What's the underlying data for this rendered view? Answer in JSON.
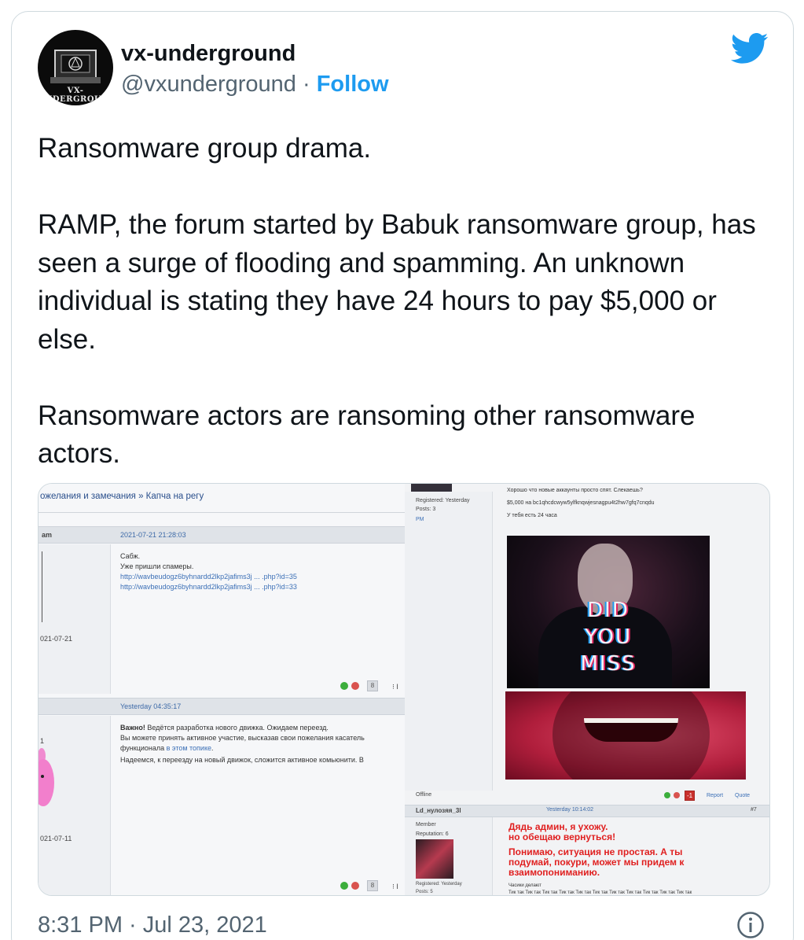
{
  "tweet": {
    "author_name": "vx-underground",
    "handle": "@vxunderground",
    "separator": "·",
    "follow_label": "Follow",
    "avatar_text": "VX-UNDERGROUND",
    "text": "Ransomware group drama.\n\nRAMP, the forum started by Babuk ransomware group, has seen a surge of flooding and spamming. An unknown individual is stating they have 24 hours to pay $5,000 or else.\n\nRansomware actors are ransoming other ransomware actors.",
    "timestamp": "8:31 PM · Jul 23, 2021",
    "icons": {
      "platform": "twitter-bird-icon",
      "info": "info-icon"
    },
    "colors": {
      "link": "#1d9bf0",
      "muted": "#536471",
      "text": "#0f1419"
    }
  },
  "forum_left": {
    "breadcrumb": "ожелания и замечания » Капча на регу",
    "post1": {
      "author_fragment": "am",
      "date": "2021-07-21 21:28:03",
      "lines": [
        "Сабж.",
        "Уже пришли спамеры."
      ],
      "links": [
        "http://wavbeudogz6byhnardd2lkp2jafims3j ... .php?id=35",
        "http://wavbeudogz6byhnardd2lkp2jafims3j ... .php?id=33"
      ],
      "joined": "021-07-21",
      "page_box": "8",
      "page_dots": "⁝ I"
    },
    "post2": {
      "date": "Yesterday 04:35:17",
      "bold_lead": "Важно!",
      "line1": "Ведётся разработка нового движка. Ожидаем переезд.",
      "line2": "Вы можете принять активное участие, высказав свои пожелания касатель",
      "line3_pre": "функционала ",
      "line3_link": "в этом топике",
      "line3_post": ".",
      "line4": "Надеемся, к переезду на новый движок, сложится активное комьюнити. В",
      "side_num": "1",
      "joined": "021-07-11",
      "page_box": "8",
      "page_dots": "⁝ I"
    }
  },
  "forum_right": {
    "top_side": {
      "registered": "Registered: Yesterday",
      "posts": "Posts: 3",
      "pm": "PM"
    },
    "top_lines": [
      "Хорошо что новые аккаунты просто спят. Слекаешь?",
      "$5,000 на bc1qhcdcwyw5ylfknqwjesnagpu4t2hw7gfq7cnqdu",
      "У тебя есть 24 часа"
    ],
    "image1_words": [
      "DID",
      "YOU",
      "MISS"
    ],
    "offline": "Offline",
    "vote_box": "-1",
    "report_label": "Report",
    "quote_label": "Quote",
    "post2": {
      "author": "Ld_нулозяя_3l",
      "date": "Yesterday 10:14:02",
      "number": "#7",
      "role": "Member",
      "reputation": "Reputation: 6",
      "registered": "Registered: Yesterday",
      "posts": "Posts: 5",
      "red_lines": [
        "Дядь админ, я ухожу.",
        "но обещаю вернуться!",
        "Понимаю, ситуация не простая. А ты",
        "подумай, покури, может мы придем к",
        "взаимопониманию."
      ],
      "small_line": "Часики делают",
      "tick_line": "Тик так Тик так Тик так Тик так Тик так Тик так Тик так Тик так Тик так Тик так Тик так"
    }
  }
}
